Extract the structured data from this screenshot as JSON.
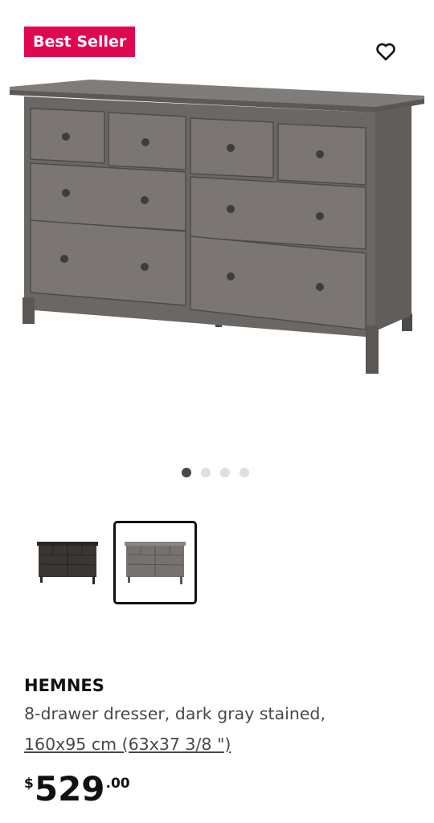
{
  "badge": {
    "label": "Best Seller",
    "color": "#e00751"
  },
  "favorite": {
    "icon": "heart-outline-icon"
  },
  "gallery": {
    "dots": 4,
    "active_dot": 0,
    "thumbnails": [
      {
        "name": "dresser-black-brown",
        "selected": false
      },
      {
        "name": "dresser-dark-gray",
        "selected": true
      }
    ]
  },
  "product": {
    "name": "HEMNES",
    "description": "8-drawer dresser, dark gray stained,",
    "size": "160x95 cm (63x37 3/8 \")",
    "price": {
      "currency": "$",
      "integer": "529",
      "decimal": ".00"
    }
  }
}
